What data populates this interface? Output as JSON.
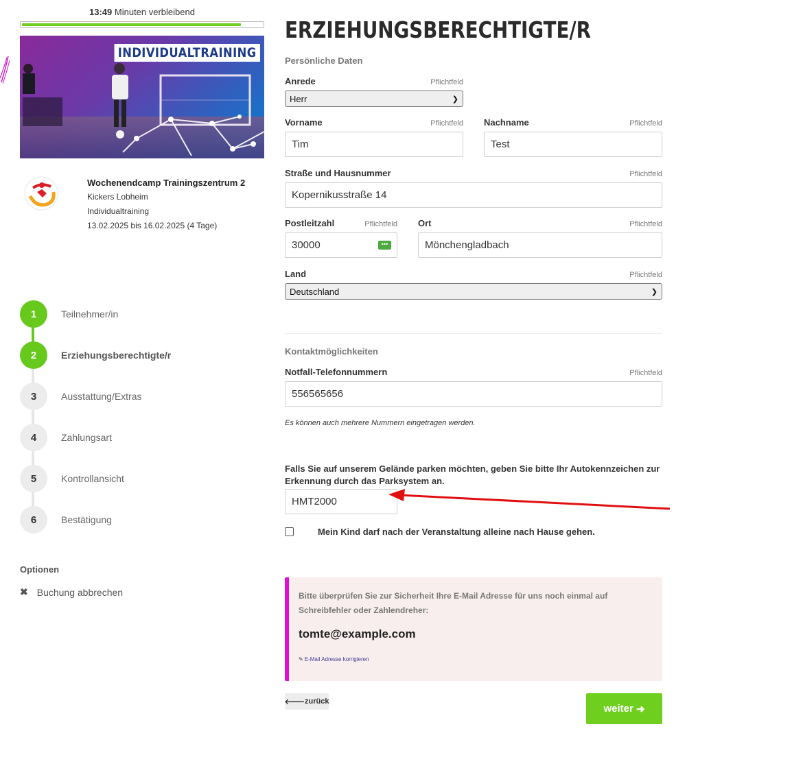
{
  "timer": {
    "time": "13:49",
    "suffix": "Minuten verbleibend",
    "progress_pct": 91
  },
  "hero": {
    "label": "INDIVIDUALTRAINING"
  },
  "event": {
    "title": "Wochenendcamp Trainingszentrum 2",
    "club": "Kickers Lobheim",
    "type": "Individualtraining",
    "dates": "13.02.2025 bis 16.02.2025 (4 Tage)"
  },
  "steps": [
    {
      "num": "1",
      "label": "Teilnehmer/in",
      "state": "done"
    },
    {
      "num": "2",
      "label": "Erziehungsberechtigte/r",
      "state": "active"
    },
    {
      "num": "3",
      "label": "Ausstattung/Extras",
      "state": "todo"
    },
    {
      "num": "4",
      "label": "Zahlungsart",
      "state": "todo"
    },
    {
      "num": "5",
      "label": "Kontrollansicht",
      "state": "todo"
    },
    {
      "num": "6",
      "label": "Bestätigung",
      "state": "todo"
    }
  ],
  "options": {
    "title": "Optionen",
    "cancel": "Buchung abbrechen"
  },
  "form": {
    "title": "ERZIEHUNGSBERECHTIGTE/R",
    "section_personal": "Persönliche Daten",
    "required": "Pflichtfeld",
    "salutation": {
      "label": "Anrede",
      "value": "Herr"
    },
    "firstname": {
      "label": "Vorname",
      "value": "Tim"
    },
    "lastname": {
      "label": "Nachname",
      "value": "Test"
    },
    "street": {
      "label": "Straße und Hausnummer",
      "value": "Kopernikusstraße 14"
    },
    "zip": {
      "label": "Postleitzahl",
      "value": "30000"
    },
    "city": {
      "label": "Ort",
      "value": "Mönchengladbach"
    },
    "country": {
      "label": "Land",
      "value": "Deutschland"
    },
    "section_contact": "Kontaktmöglichkeiten",
    "phone": {
      "label": "Notfall-Telefonnummern",
      "value": "556565656"
    },
    "phone_hint": "Es können auch mehrere Nummern eingetragen werden.",
    "parking_text": "Falls Sie auf unserem Gelände parken möchten, geben Sie bitte Ihr Autokennzeichen zur Erkennung durch das Parksystem an.",
    "plate": "HMT2000",
    "alone_home": "Mein Kind darf nach der Veranstaltung alleine nach Hause gehen."
  },
  "email_box": {
    "text": "Bitte überprüfen Sie zur Sicherheit Ihre E-Mail Adresse für uns noch einmal auf Schreibfehler oder Zahlendreher:",
    "email": "tomte@example.com",
    "correct_link": "E-Mail Adresse korrigieren"
  },
  "nav": {
    "back": "zurück",
    "next": "weiter"
  },
  "colors": {
    "accent_green": "#6fcf1f",
    "step_green": "#66c91c",
    "magenta": "#e10fd3",
    "arrow_red": "#e01010"
  }
}
